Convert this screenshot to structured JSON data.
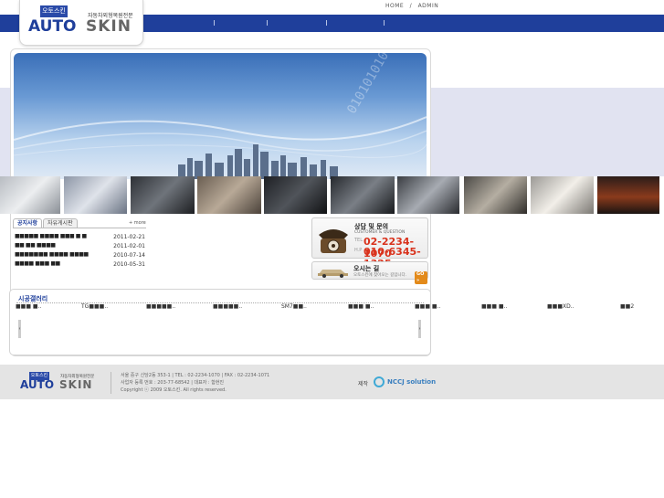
{
  "util_links": {
    "home": "HOME",
    "separator": "/",
    "admin": "ADMIN"
  },
  "logo": {
    "badge": "오토스킨",
    "auto": "AUTO",
    "skin": "SKIN",
    "tagline": "자동차외형복원전문"
  },
  "notice": {
    "tab_active": "공지사항",
    "tab_inactive": "자유게시판",
    "more": "+ more",
    "rows": [
      {
        "title": "■■■■■ ■■■■ ■■■ ■ ■",
        "date": "2011-02-21"
      },
      {
        "title": "■■ ■■ ■■■■",
        "date": "2011-02-01"
      },
      {
        "title": "■■■■■■■ ■■■■ ■■■■",
        "date": "2010-07-14"
      },
      {
        "title": "■■■■ ■■■ ■■",
        "date": "2010-05-31"
      }
    ]
  },
  "consult": {
    "title": "상담 및 문의",
    "subtitle": "CUSTOMER & QUESTION",
    "tel_label": "TEL",
    "tel": "02-2234-1070",
    "hp_label": "H.P",
    "hp": "010-6345-1325"
  },
  "directions": {
    "title": "오시는 길",
    "subtitle": "오토스킨에 찾아오는 길입니다.",
    "go": "GO »"
  },
  "gallery": {
    "title": "시공갤러리",
    "items": [
      "■■■ ■..",
      "TG■■■..",
      "■■■■■..",
      "■■■■■..",
      "SM7■■..",
      "■■■ ■..",
      "■■■ ■..",
      "■■■ ■..",
      "■■■XD..",
      "■■2"
    ],
    "prev": "‹",
    "next": "›"
  },
  "footer": {
    "address": "서울 중구 신당2동 353-1 | TEL : 02-2234-1070 | FAX : 02-2234-1071",
    "business": "사업자 등록 번호 : 203-77-68542 | 대표자 : 함현진",
    "copyright": "Copyright ⓒ 2009 오토스킨. All rights reserved.",
    "maker_label": "제작",
    "maker": "NCCJ solution"
  },
  "colors": {
    "nav": "#1f3f9b",
    "band": "#e1e3f1",
    "accent_red": "#d9321c",
    "footer": "#e4e4e4"
  }
}
